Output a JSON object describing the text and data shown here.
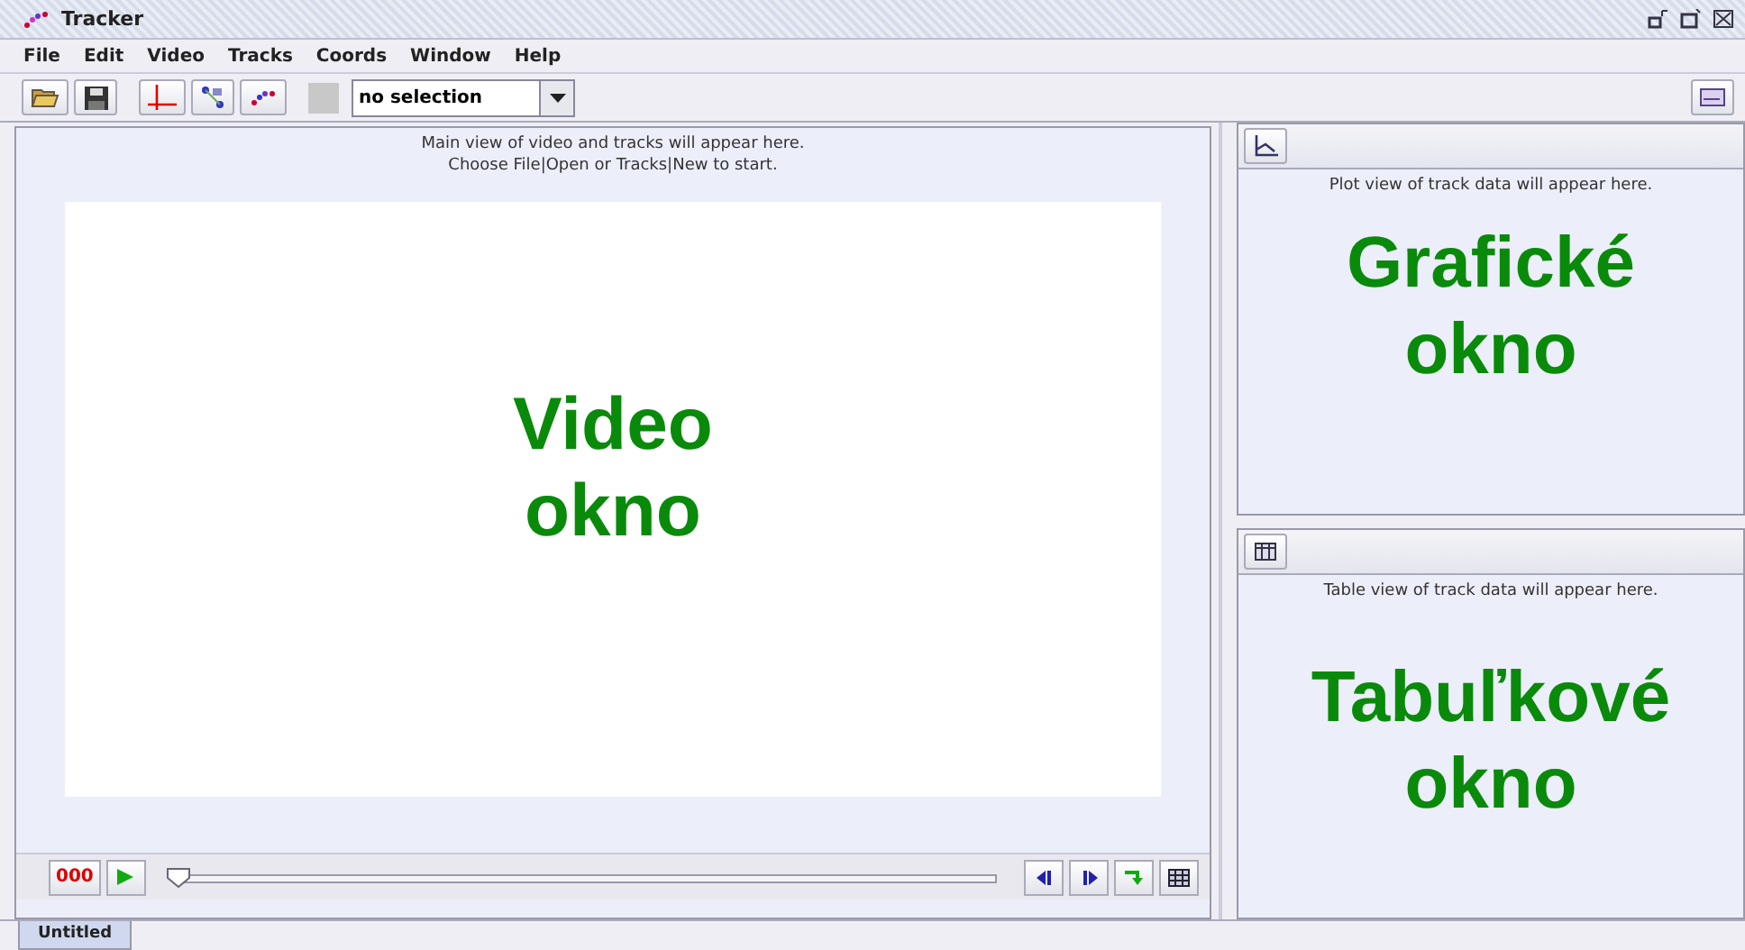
{
  "window": {
    "title": "Tracker"
  },
  "menu": [
    "File",
    "Edit",
    "Video",
    "Tracks",
    "Coords",
    "Window",
    "Help"
  ],
  "toolbar": {
    "selection": "no selection"
  },
  "video_view": {
    "message_lines": [
      "Main view of video and tracks will appear here.",
      "Choose File|Open or Tracks|New to start."
    ],
    "overlay_lines": [
      "Video",
      "okno"
    ],
    "player": {
      "frame": "000",
      "slider": {
        "level": 0
      }
    }
  },
  "plot_view": {
    "message": "Plot view of track data will appear here.",
    "overlay_lines": [
      "Grafické",
      "okno"
    ]
  },
  "table_view": {
    "message": "Table view of track data will appear here.",
    "overlay_lines": [
      "Tabuľkové",
      "okno"
    ]
  },
  "tabs": [
    {
      "label": "Untitled",
      "selected": true
    }
  ]
}
